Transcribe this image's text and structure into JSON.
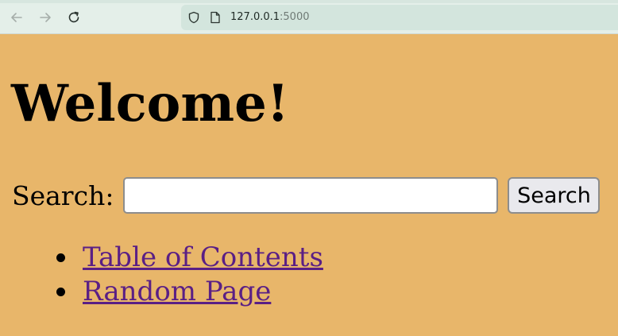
{
  "browser": {
    "back_icon": "arrow-left-icon",
    "forward_icon": "arrow-right-icon",
    "reload_icon": "reload-icon",
    "security_icon": "shield-icon",
    "page_icon": "page-icon",
    "url_host": "127.0.0.1",
    "url_port": ":5000"
  },
  "page": {
    "title": "Welcome!",
    "search": {
      "label": "Search:",
      "value": "",
      "placeholder": "",
      "button_label": "Search"
    },
    "links": [
      {
        "label": "Table of Contents"
      },
      {
        "label": "Random Page"
      }
    ]
  },
  "colors": {
    "page_background": "#e8b66a",
    "link": "#5a1f85",
    "chrome_background": "#e4efe9"
  }
}
